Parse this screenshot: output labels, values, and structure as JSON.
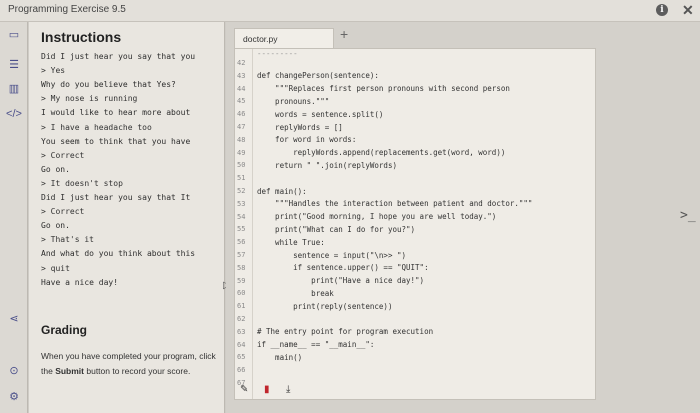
{
  "window": {
    "title": "Programming Exercise 9.5"
  },
  "instructions": {
    "heading": "Instructions",
    "transcript": [
      "Did I just hear you say that you",
      "> Yes",
      "Why do you believe that Yes?",
      "> My nose is running",
      "I would like to hear more about",
      "> I have a headache too",
      "You seem to think that you have",
      "> Correct",
      "Go on.",
      "> It doesn't stop",
      "Did I just hear you say that It",
      "> Correct",
      "Go on.",
      "> That's it",
      "And what do you think about this",
      "> quit",
      "Have a nice day!"
    ]
  },
  "grading": {
    "heading": "Grading",
    "text_before": "When you have completed your program, click the ",
    "submit_word": "Submit",
    "text_after": " button to record your score."
  },
  "editor": {
    "tab_label": "doctor.py",
    "add_tab_symbol": "+",
    "first_line_fragment": "---------",
    "line_numbers": [
      "42",
      "43",
      "44",
      "45",
      "46",
      "47",
      "48",
      "49",
      "50",
      "51",
      "52",
      "53",
      "54",
      "55",
      "56",
      "57",
      "58",
      "59",
      "60",
      "61",
      "62",
      "63",
      "64",
      "65",
      "66",
      "67"
    ],
    "code_lines": [
      "",
      "def changePerson(sentence):",
      "    \"\"\"Replaces first person pronouns with second person",
      "    pronouns.\"\"\"",
      "    words = sentence.split()",
      "    replyWords = []",
      "    for word in words:",
      "        replyWords.append(replacements.get(word, word))",
      "    return \" \".join(replyWords)",
      "",
      "def main():",
      "    \"\"\"Handles the interaction between patient and doctor.\"\"\"",
      "    print(\"Good morning, I hope you are well today.\")",
      "    print(\"What can I do for you?\")",
      "    while True:",
      "        sentence = input(\"\\n>> \")",
      "        if sentence.upper() == \"QUIT\":",
      "            print(\"Have a nice day!\")",
      "            break",
      "        print(reply(sentence))",
      "",
      "# The entry point for program execution",
      "if __name__ == \"__main__\":",
      "    main()",
      "",
      ""
    ]
  },
  "toolbar": {
    "pencil_icon": "pencil-icon",
    "pin_icon": "pin-icon",
    "download_icon": "download-icon"
  },
  "colors": {
    "rail_icon": "#4a4f8a",
    "pin": "#c0262d",
    "pencil": "#333333"
  }
}
